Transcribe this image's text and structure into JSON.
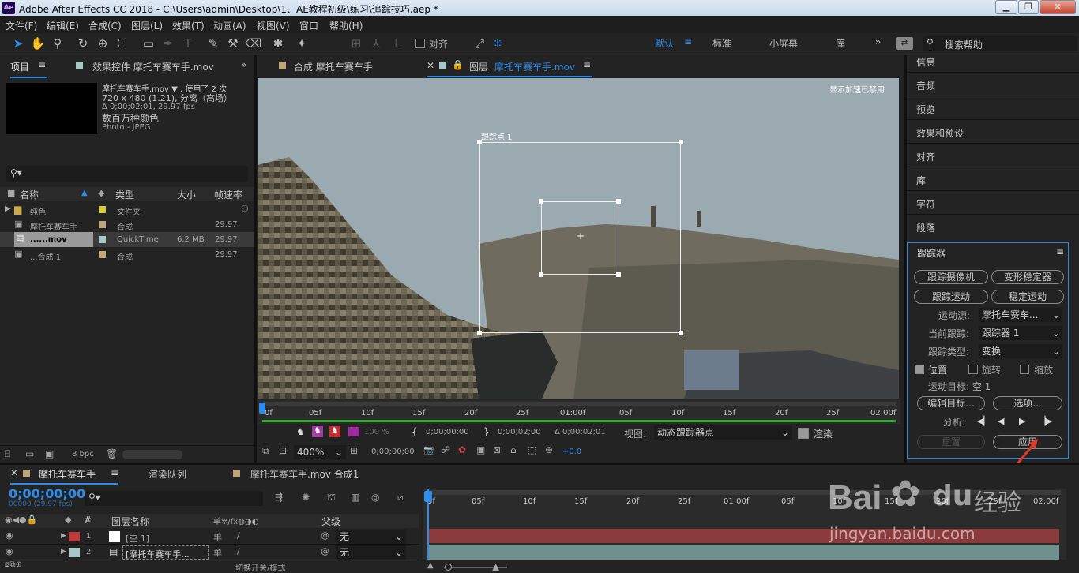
{
  "window": {
    "title": "Adobe After Effects CC 2018 - C:\\Users\\admin\\Desktop\\1、AE教程初级\\练习\\追踪技巧.aep *",
    "app_icon": "Ae",
    "minimize": "▁",
    "maximize": "❐",
    "close": "✕"
  },
  "menu": [
    "文件(F)",
    "编辑(E)",
    "合成(C)",
    "图层(L)",
    "效果(T)",
    "动画(A)",
    "视图(V)",
    "窗口",
    "帮助(H)"
  ],
  "toolbar": {
    "align_label": "对齐",
    "workspaces": [
      "默认",
      "标准",
      "小屏幕",
      "库"
    ],
    "more": "»",
    "search_placeholder": "搜索帮助"
  },
  "project": {
    "tab_label": "项目",
    "effects_tab": "效果控件 摩托车赛车手.mov",
    "more": "»",
    "info": {
      "name": "摩托车赛车手.mov ▼ , 使用了 2 次",
      "dims": "720 x 480 (1.21), 分离（高场）",
      "duration": "Δ 0;00;02;01, 29.97 fps",
      "colors": "数百万种颜色",
      "codec": "Photo - JPEG"
    },
    "search_placeholder": "",
    "columns": {
      "name": "名称",
      "type": "类型",
      "size": "大小",
      "fps": "帧速率"
    },
    "rows": [
      {
        "name": "纯色",
        "type": "文件夹",
        "size": "",
        "fps": "",
        "color": "#d6cc3a",
        "icon": "folder-icon"
      },
      {
        "name": "摩托车赛车手",
        "type": "合成",
        "size": "",
        "fps": "29.97",
        "color": "#bfa57a",
        "icon": "composition-icon"
      },
      {
        "name": "......mov",
        "type": "QuickTime",
        "size": "6.2 MB",
        "fps": "29.97",
        "color": "#a7c8c6",
        "icon": "footage-icon"
      },
      {
        "name": "...合成 1",
        "type": "合成",
        "size": "",
        "fps": "29.97",
        "color": "#bfa57a",
        "icon": "composition-icon"
      }
    ],
    "bpc": "8 bpc"
  },
  "viewer": {
    "tab1": "合成 摩托车赛车手",
    "tab2_prefix": "图层",
    "tab2_name": "摩托车赛车手.mov",
    "accel_note": "显示加速已禁用",
    "track_point": "跟踪点 1",
    "ruler": [
      "0f",
      "05f",
      "10f",
      "15f",
      "20f",
      "25f",
      "01:00f",
      "05f",
      "10f",
      "15f",
      "20f",
      "25f",
      "02:00f"
    ],
    "in_time": "0;00;00;00",
    "out_time": "0;00;02;00",
    "duration": "Δ 0;00;02;01",
    "view_label": "视图:",
    "view_value": "动态跟踪器点",
    "render_label": "渲染",
    "zoom": "400%",
    "timecode": "0;00;00;00",
    "exposure": "+0.0",
    "percent": "100 %"
  },
  "right_panels": [
    "信息",
    "音频",
    "预览",
    "效果和预设",
    "对齐",
    "库",
    "字符",
    "段落"
  ],
  "tracker": {
    "title": "跟踪器",
    "btn_camera": "跟踪摄像机",
    "btn_warp": "变形稳定器",
    "btn_track": "跟踪运动",
    "btn_stabilize": "稳定运动",
    "source_label": "运动源:",
    "source_value": "摩托车赛车...",
    "current_label": "当前跟踪:",
    "current_value": "跟踪器 1",
    "type_label": "跟踪类型:",
    "type_value": "变换",
    "position": "位置",
    "rotation": "旋转",
    "scale": "缩放",
    "target_label": "运动目标: 空 1",
    "edit_target": "编辑目标...",
    "options": "选项...",
    "analyze_label": "分析:",
    "reset": "重置",
    "apply": "应用",
    "position_checked": true,
    "rotation_checked": false,
    "scale_checked": false
  },
  "timeline": {
    "tab_comp": "摩托车赛车手",
    "tab_render": "渲染队列",
    "tab_comp2": "摩托车赛车手.mov 合成1",
    "timecode": "0;00;00;00",
    "frame_info": "00000 (29.97 fps)",
    "col_num": "#",
    "col_layer_name": "图层名称",
    "col_parent": "父级",
    "switch_label": "切换开关/模式",
    "layers": [
      {
        "num": "1",
        "name": "[空 1]",
        "parent": "无",
        "color": "#c0393b",
        "bar": "#8b3a3c"
      },
      {
        "num": "2",
        "name": "[摩托车赛车手...",
        "parent": "无",
        "color": "#a7c8c6",
        "bar": "#6f8f8d"
      }
    ],
    "ruler": [
      "0f",
      "05f",
      "10f",
      "15f",
      "20f",
      "25f",
      "01:00f",
      "05f",
      "10f",
      "15f",
      "20f",
      "25f",
      "02:00f"
    ]
  },
  "watermark": {
    "brand": "Bai",
    "brand2": "经验",
    "url": "jingyan.baidu.com"
  },
  "colors": {
    "accent": "#2d8ceb",
    "bg": "#232323",
    "viewer_bg": "#9aa9b0",
    "annotation": "#e23a2a"
  }
}
